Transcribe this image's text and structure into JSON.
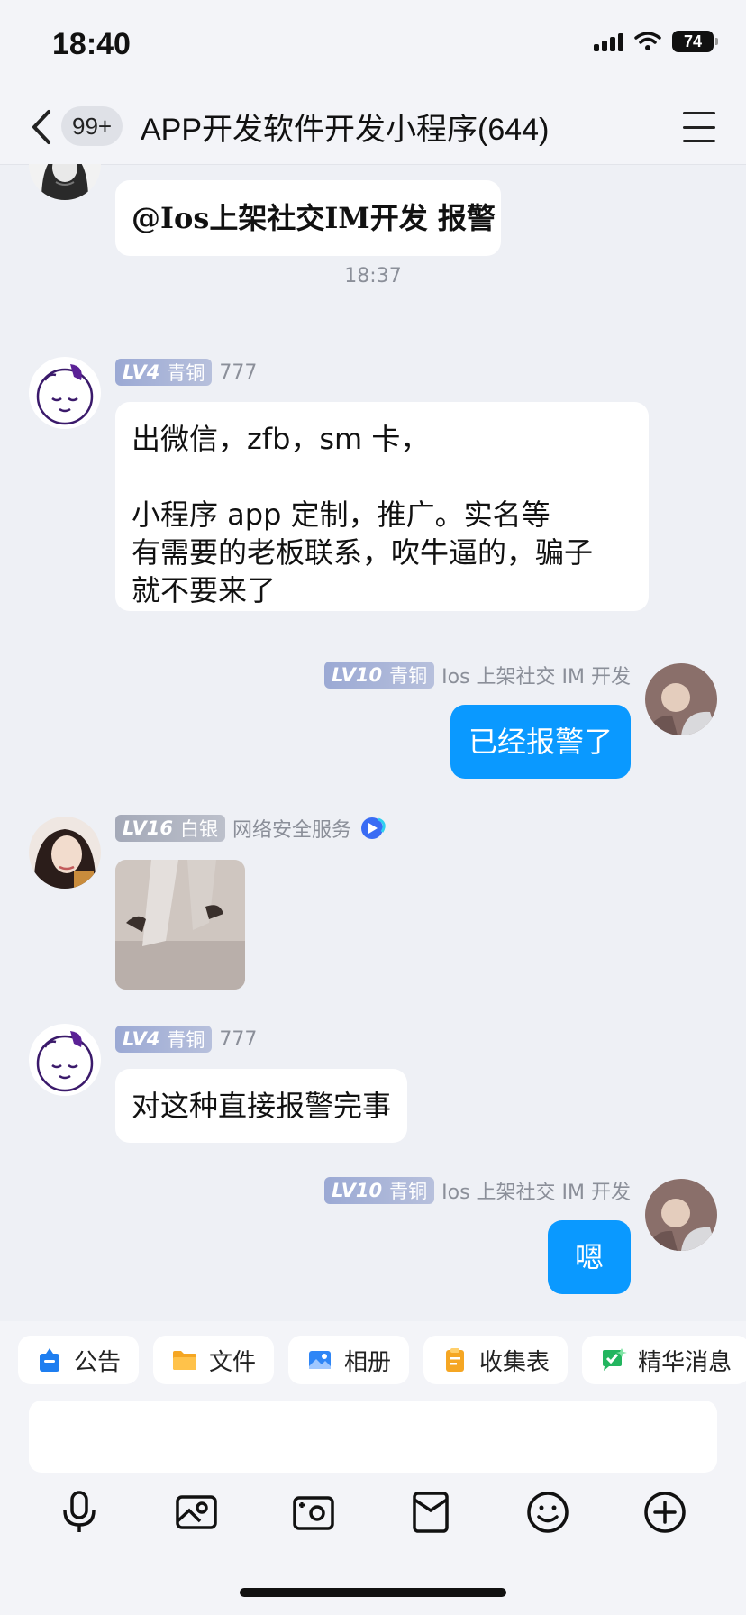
{
  "status": {
    "time": "18:40",
    "battery": "74"
  },
  "nav": {
    "unread": "99+",
    "title": "APP开发软件开发小程序(644)"
  },
  "messages": {
    "m0": {
      "text": "@Ios上架社交IM开发 报警"
    },
    "timestamp": "18:37",
    "m1": {
      "level": "LV4",
      "rank": "青铜",
      "name": "777",
      "line1": "出微信，zfb，sm 卡，",
      "line2": "",
      "line3": "小程序  app 定制，推广。实名等",
      "line4": "有需要的老板联系，吹牛逼的，骗子",
      "line5": "就不要来了"
    },
    "m2": {
      "level": "LV10",
      "rank": "青铜",
      "name": "Ios 上架社交 IM 开发",
      "text": "已经报警了"
    },
    "m3": {
      "level": "LV16",
      "rank": "白银",
      "name": "网络安全服务"
    },
    "m4": {
      "level": "LV4",
      "rank": "青铜",
      "name": "777",
      "text": "对这种直接报警完事"
    },
    "m5": {
      "level": "LV10",
      "rank": "青铜",
      "name": "Ios 上架社交 IM 开发",
      "text": "嗯"
    }
  },
  "toolbar": {
    "chips": [
      {
        "label": "公告",
        "icon": "announcement-icon"
      },
      {
        "label": "文件",
        "icon": "folder-icon"
      },
      {
        "label": "相册",
        "icon": "album-icon"
      },
      {
        "label": "收集表",
        "icon": "form-icon"
      },
      {
        "label": "精华消息",
        "icon": "essence-icon"
      }
    ],
    "input_value": "",
    "icons": [
      "microphone-icon",
      "image-icon",
      "camera-icon",
      "red-packet-icon",
      "emoji-icon",
      "plus-icon"
    ]
  },
  "colors": {
    "accent": "#0a99ff",
    "background": "#eef0f5",
    "bubble": "#ffffff"
  }
}
